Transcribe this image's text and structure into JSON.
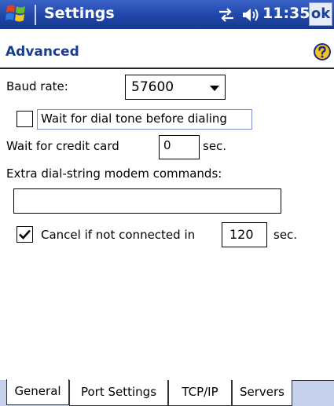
{
  "titlebar": {
    "title": "Settings",
    "time": "11:35",
    "ok_label": "ok"
  },
  "header": {
    "title": "Advanced"
  },
  "form": {
    "baud_label": "Baud rate:",
    "baud_value": "57600",
    "dial_tone_label": "Wait for dial tone before dialing",
    "dial_tone_checked": false,
    "credit_label": "Wait for credit card",
    "credit_value": "0",
    "credit_unit": "sec.",
    "extra_label": "Extra dial-string modem commands:",
    "extra_value": "",
    "cancel_label": "Cancel if not connected in",
    "cancel_checked": true,
    "cancel_value": "120",
    "cancel_unit": "sec."
  },
  "tabs": [
    {
      "label": "General",
      "active": true
    },
    {
      "label": "Port Settings",
      "active": false
    },
    {
      "label": "TCP/IP",
      "active": false
    },
    {
      "label": "Servers",
      "active": false
    }
  ]
}
